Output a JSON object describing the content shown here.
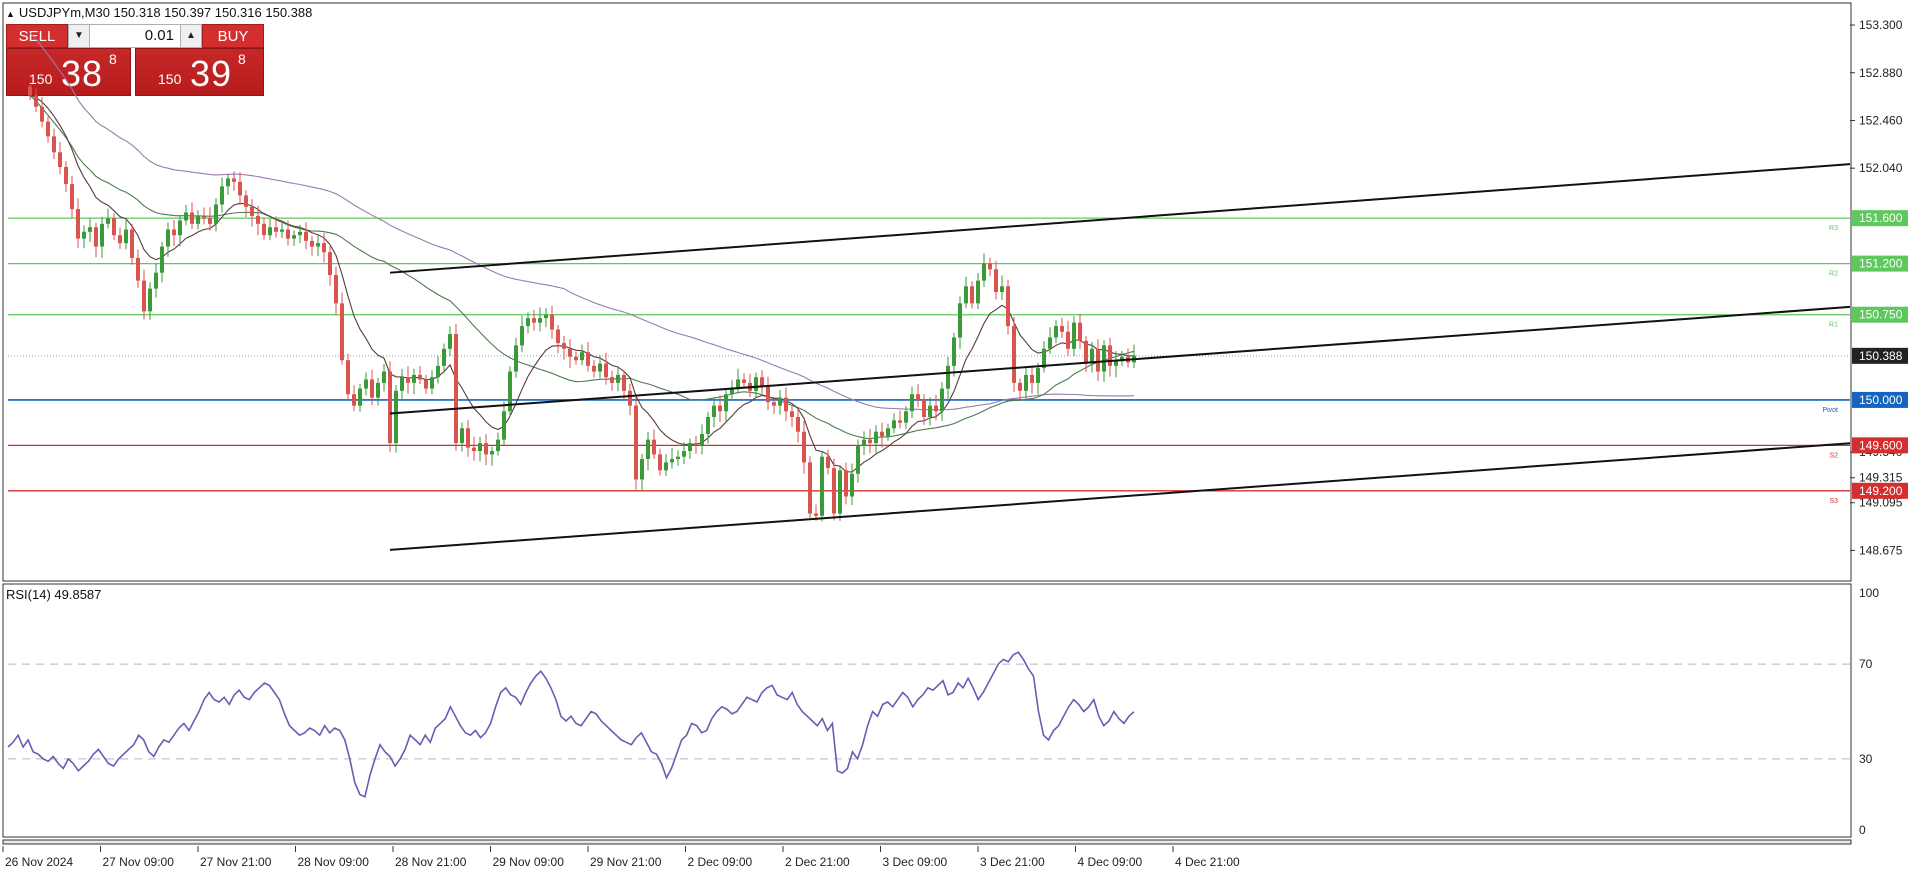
{
  "header": {
    "symbol_line": "USDJPYm,M30  150.318 150.397 150.316 150.388",
    "rsi_label": "RSI(14) 49.8587"
  },
  "trade_panel": {
    "sell_label": "SELL",
    "buy_label": "BUY",
    "lot": "0.01",
    "sell_price_small": "150",
    "sell_price_big": "38",
    "sell_price_sup": "8",
    "buy_price_small": "150",
    "buy_price_big": "39",
    "buy_price_sup": "8"
  },
  "colors": {
    "bull": "#3a9a3a",
    "bear": "#d9534f",
    "rsi": "#6b5bb5",
    "level_green": "#5ec85e",
    "level_blue": "#1565c0",
    "level_red": "#d32f2f",
    "ma_purple": "#9b7bb0",
    "ma_green": "#4c7c4c",
    "ma_dark": "#5a3a3a"
  },
  "chart_data": [
    {
      "type": "candlestick",
      "title": "USDJPYm,M30",
      "ylim": [
        148.45,
        153.45
      ],
      "y_ticks": [
        "153.300",
        "152.880",
        "152.460",
        "152.040",
        "149.540",
        "149.315",
        "149.095",
        "148.675"
      ],
      "x_ticks": [
        "26 Nov 2024",
        "27 Nov 09:00",
        "27 Nov 21:00",
        "28 Nov 09:00",
        "28 Nov 21:00",
        "29 Nov 09:00",
        "29 Nov 21:00",
        "2 Dec 09:00",
        "2 Dec 21:00",
        "3 Dec 09:00",
        "3 Dec 21:00",
        "4 Dec 09:00",
        "4 Dec 21:00"
      ],
      "current_price": 150.388,
      "levels": [
        {
          "label": "151.600",
          "value": 151.6,
          "kind": "resistance",
          "tag": "R3"
        },
        {
          "label": "151.200",
          "value": 151.2,
          "kind": "resistance",
          "tag": "R2"
        },
        {
          "label": "150.750",
          "value": 150.75,
          "kind": "resistance",
          "tag": "R1"
        },
        {
          "label": "150.000",
          "value": 150.0,
          "kind": "pivot",
          "tag": "Pivot"
        },
        {
          "label": "149.600",
          "value": 149.6,
          "kind": "support",
          "tag": "S2"
        },
        {
          "label": "149.200",
          "value": 149.2,
          "kind": "support",
          "tag": "S3"
        }
      ],
      "trendlines": [
        {
          "x0": 60,
          "y0": 151.12,
          "x1": 200,
          "y1": 151.67
        },
        {
          "x0": 60,
          "y0": 149.88,
          "x1": 200,
          "y1": 150.42
        },
        {
          "x0": 60,
          "y0": 148.68,
          "x1": 200,
          "y1": 149.22
        }
      ],
      "close": [
        152.68,
        152.58,
        152.45,
        152.32,
        152.18,
        152.05,
        151.9,
        151.68,
        151.42,
        151.48,
        151.52,
        151.35,
        151.55,
        151.6,
        151.45,
        151.38,
        151.5,
        151.25,
        151.05,
        150.78,
        150.98,
        151.12,
        151.35,
        151.5,
        151.45,
        151.58,
        151.65,
        151.55,
        151.62,
        151.6,
        151.55,
        151.72,
        151.88,
        151.95,
        151.92,
        151.8,
        151.7,
        151.62,
        151.55,
        151.45,
        151.52,
        151.48,
        151.5,
        151.42,
        151.45,
        151.48,
        151.4,
        151.35,
        151.38,
        151.3,
        151.1,
        150.85,
        150.35,
        150.05,
        149.95,
        150.1,
        150.18,
        150.02,
        150.15,
        150.25,
        149.62,
        150.08,
        150.2,
        150.15,
        150.22,
        150.18,
        150.1,
        150.2,
        150.3,
        150.45,
        150.58,
        149.62,
        149.75,
        149.58,
        149.55,
        149.62,
        149.52,
        149.55,
        149.65,
        149.9,
        150.25,
        150.48,
        150.65,
        150.72,
        150.68,
        150.72,
        150.75,
        150.62,
        150.5,
        150.45,
        150.38,
        150.35,
        150.42,
        150.3,
        150.25,
        150.32,
        150.2,
        150.15,
        150.22,
        150.08,
        149.95,
        149.3,
        149.48,
        149.65,
        149.52,
        149.38,
        149.45,
        149.48,
        149.5,
        149.55,
        149.62,
        149.6,
        149.7,
        149.85,
        149.95,
        149.9,
        150.05,
        150.1,
        150.18,
        150.15,
        150.08,
        150.2,
        150.12,
        149.98,
        149.95,
        150.02,
        149.9,
        149.85,
        149.72,
        149.45,
        149.0,
        148.98,
        149.5,
        149.4,
        149.0,
        149.38,
        149.15,
        149.35,
        149.6,
        149.65,
        149.62,
        149.72,
        149.68,
        149.75,
        149.82,
        149.8,
        149.9,
        150.05,
        150.0,
        149.85,
        149.95,
        149.9,
        150.1,
        150.3,
        150.55,
        150.85,
        151.0,
        150.85,
        151.05,
        151.2,
        151.15,
        150.95,
        151.0,
        150.65,
        150.15,
        150.08,
        150.22,
        150.15,
        150.28,
        150.45,
        150.55,
        150.65,
        150.6,
        150.45,
        150.68,
        150.52,
        150.32,
        150.45,
        150.25,
        150.48,
        150.3,
        150.34,
        150.38,
        150.33,
        150.39
      ],
      "rsi": {
        "label": "RSI(14) 49.8587",
        "ylim": [
          0,
          100
        ],
        "y_ticks": [
          "100",
          "70",
          "30",
          "0"
        ],
        "levels": [
          70,
          30
        ],
        "values": [
          35,
          37,
          40,
          35,
          38,
          33,
          32,
          30,
          29,
          31,
          28,
          26,
          30,
          28,
          25,
          27,
          29,
          32,
          34,
          31,
          28,
          27,
          30,
          32,
          34,
          36,
          40,
          38,
          33,
          31,
          35,
          38,
          37,
          40,
          43,
          45,
          42,
          46,
          50,
          55,
          58,
          55,
          54,
          56,
          53,
          57,
          59,
          56,
          55,
          58,
          60,
          62,
          61,
          58,
          55,
          49,
          44,
          42,
          40,
          41,
          43,
          42,
          40,
          44,
          41,
          43,
          42,
          38,
          30,
          20,
          15,
          14,
          23,
          30,
          36,
          33,
          31,
          27,
          30,
          34,
          40,
          38,
          36,
          40,
          37,
          43,
          45,
          47,
          52,
          48,
          44,
          41,
          40,
          42,
          39,
          41,
          45,
          52,
          58,
          60,
          57,
          56,
          53,
          58,
          62,
          65,
          67,
          64,
          60,
          55,
          48,
          46,
          48,
          45,
          44,
          47,
          50,
          49,
          46,
          44,
          42,
          40,
          38,
          37,
          36,
          39,
          41,
          37,
          33,
          32,
          28,
          22,
          26,
          32,
          38,
          40,
          45,
          44,
          41,
          42,
          47,
          50,
          52,
          51,
          49,
          50,
          53,
          56,
          55,
          54,
          58,
          60,
          61,
          57,
          56,
          55,
          58,
          53,
          50,
          48,
          46,
          44,
          47,
          42,
          45,
          25,
          24,
          26,
          33,
          30,
          36,
          44,
          50,
          48,
          53,
          54,
          52,
          55,
          58,
          56,
          52,
          55,
          57,
          60,
          59,
          61,
          63,
          57,
          58,
          62,
          60,
          64,
          60,
          55,
          58,
          62,
          66,
          70,
          72,
          71,
          74,
          75,
          72,
          68,
          65,
          50,
          40,
          38,
          42,
          44,
          48,
          52,
          55,
          53,
          50,
          52,
          55,
          48,
          44,
          46,
          50,
          47,
          45,
          48,
          49.8587
        ]
      }
    }
  ]
}
